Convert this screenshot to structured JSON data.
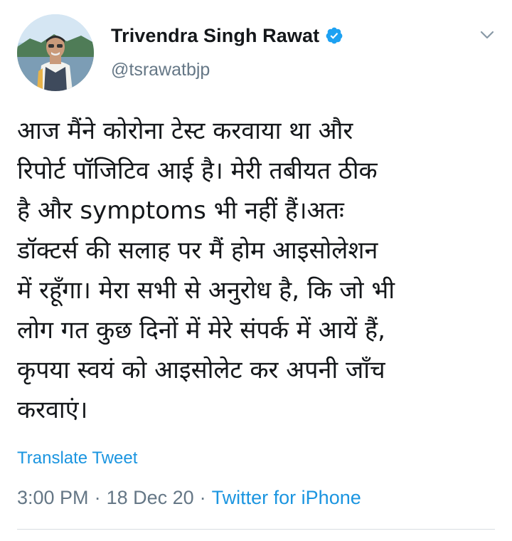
{
  "author": {
    "display_name": "Trivendra Singh Rawat",
    "handle": "@tsrawatbjp",
    "verified": true,
    "verified_color": "#1da1f2"
  },
  "tweet": {
    "text": "आज मैंने कोरोना टेस्ट करवाया था और\nरिपोर्ट पॉजिटिव आई है। मेरी तबीयत ठीक\nहै और symptoms भी नहीं हैं।अतः\nडॉक्टर्स की सलाह पर मैं होम आइसोलेशन\nमें रहूँगा। मेरा सभी से अनुरोध है, कि जो भी\nलोग गत कुछ दिनों में मेरे संपर्क में आयें हैं,\nकृपया स्वयं को आइसोलेट कर अपनी जाँच\nकरवाएं।",
    "translate_label": "Translate Tweet",
    "time": "3:00 PM",
    "date": "18 Dec 20",
    "source": "Twitter for iPhone",
    "separator": "·"
  },
  "icons": {
    "verified": "verified-badge-icon",
    "menu": "chevron-down-icon"
  },
  "colors": {
    "link": "#1b95e0",
    "secondary_text": "#657786",
    "primary_text": "#14171a"
  }
}
